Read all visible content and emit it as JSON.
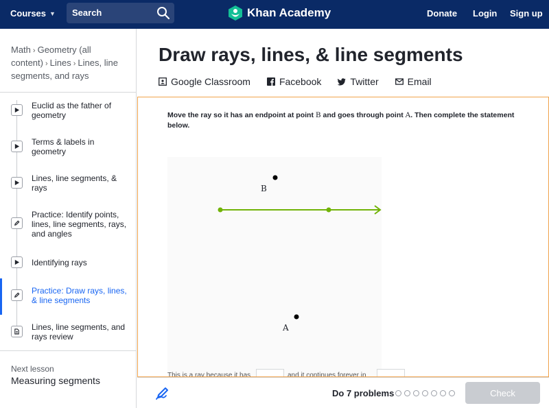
{
  "nav": {
    "courses": "Courses",
    "search_label": "Search",
    "logo_text": "Khan Academy",
    "donate": "Donate",
    "login": "Login",
    "signup": "Sign up"
  },
  "breadcrumb": {
    "items": [
      "Math",
      "Geometry (all content)",
      "Lines",
      "Lines, line segments, and rays"
    ]
  },
  "sidebar": {
    "items": [
      {
        "label": "Euclid as the father of geometry",
        "icon": "play-icon",
        "active": false
      },
      {
        "label": "Terms & labels in geometry",
        "icon": "play-icon",
        "active": false
      },
      {
        "label": "Lines, line segments, & rays",
        "icon": "play-icon",
        "active": false
      },
      {
        "label": "Practice: Identify points, lines, line segments, rays, and angles",
        "icon": "pencil-icon",
        "active": false
      },
      {
        "label": "Identifying rays",
        "icon": "play-icon",
        "active": false
      },
      {
        "label": "Practice: Draw rays, lines, & line segments",
        "icon": "pencil-icon",
        "active": true
      },
      {
        "label": "Lines, line segments, and rays review",
        "icon": "article-icon",
        "active": false
      }
    ],
    "next_label": "Next lesson",
    "next_title": "Measuring segments"
  },
  "main": {
    "title": "Draw rays, lines, & line segments",
    "share": [
      {
        "label": "Google Classroom",
        "icon": "google-classroom-icon"
      },
      {
        "label": "Facebook",
        "icon": "facebook-icon"
      },
      {
        "label": "Twitter",
        "icon": "twitter-icon"
      },
      {
        "label": "Email",
        "icon": "email-icon"
      }
    ]
  },
  "exercise": {
    "prompt_1": "Move the ray so it has an endpoint at point ",
    "point_b": "B",
    "prompt_2": " and goes through point ",
    "point_a": "A",
    "prompt_3": ". Then complete the statement below.",
    "label_b": "B",
    "label_a": "A",
    "statement_1": "This is a ray because it has",
    "statement_2": "and it continues forever in"
  },
  "bottom": {
    "do_problems": "Do 7 problems",
    "problem_count": 7,
    "check": "Check"
  },
  "colors": {
    "nav_bg": "#0a2a66",
    "ray": "#71b307",
    "active": "#1865f2",
    "exercise_border": "#f0a24a"
  }
}
